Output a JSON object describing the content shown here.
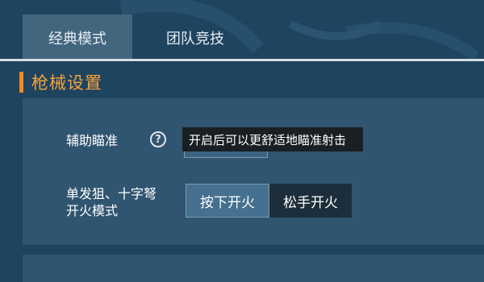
{
  "tabs": [
    {
      "label": "经典模式",
      "selected": true
    },
    {
      "label": "团队竞技",
      "selected": false
    }
  ],
  "section": {
    "title": "枪械设置"
  },
  "settings": {
    "aim_assist": {
      "label": "辅助瞄准",
      "help_icon": "question-circle-icon",
      "tooltip": "开启后可以更舒适地瞄准射击"
    },
    "fire_mode": {
      "label_line1": "单发狙、十字弩",
      "label_line2": "开火模式",
      "options": [
        {
          "label": "按下开火",
          "selected": true
        },
        {
          "label": "松手开火",
          "selected": false
        }
      ]
    }
  },
  "colors": {
    "background": "#1e4460",
    "panel": "#305571",
    "accent": "#f28b1e",
    "tooltip_bg": "#1a1f23"
  }
}
